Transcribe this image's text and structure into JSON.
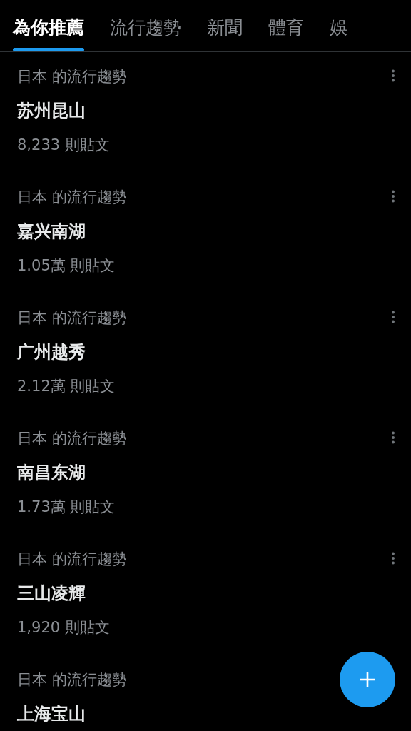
{
  "tabs": [
    {
      "label": "為你推薦",
      "selected": true
    },
    {
      "label": "流行趨勢",
      "selected": false
    },
    {
      "label": "新聞",
      "selected": false
    },
    {
      "label": "體育",
      "selected": false
    },
    {
      "label": "娛",
      "selected": false
    }
  ],
  "trends": [
    {
      "context": "日本 的流行趨勢",
      "title": "苏州昆山",
      "count": "8,233 則貼文",
      "menu_visible": true
    },
    {
      "context": "日本 的流行趨勢",
      "title": "嘉兴南湖",
      "count": "1.05萬 則貼文",
      "menu_visible": true
    },
    {
      "context": "日本 的流行趨勢",
      "title": "广州越秀",
      "count": "2.12萬 則貼文",
      "menu_visible": true
    },
    {
      "context": "日本 的流行趨勢",
      "title": "南昌东湖",
      "count": "1.73萬 則貼文",
      "menu_visible": true
    },
    {
      "context": "日本 的流行趨勢",
      "title": "三山凌輝",
      "count": "1,920 則貼文",
      "menu_visible": true
    },
    {
      "context": "日本 的流行趨勢",
      "title": "上海宝山",
      "menu_visible": false
    }
  ]
}
